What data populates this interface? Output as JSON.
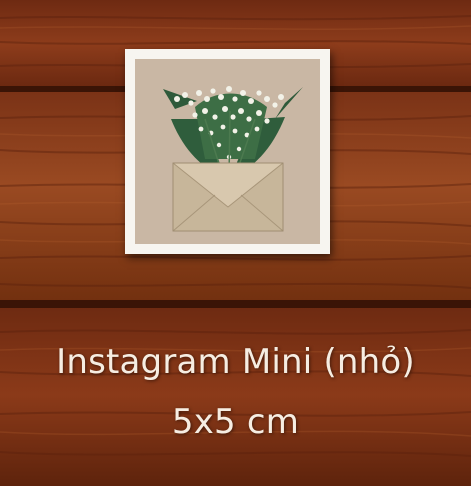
{
  "product": {
    "name": "Instagram Mini (nhỏ)",
    "size": "5x5 cm"
  },
  "colors": {
    "wood_dark": "#5a220d",
    "wood_mid": "#8a3a1a",
    "wood_light": "#a4532a",
    "frame": "#f7f5f0",
    "photo_bg": "#c9b7a4",
    "caption_text": "#f6ede2"
  },
  "icons": {
    "photo": "envelope-with-lily-of-the-valley"
  }
}
